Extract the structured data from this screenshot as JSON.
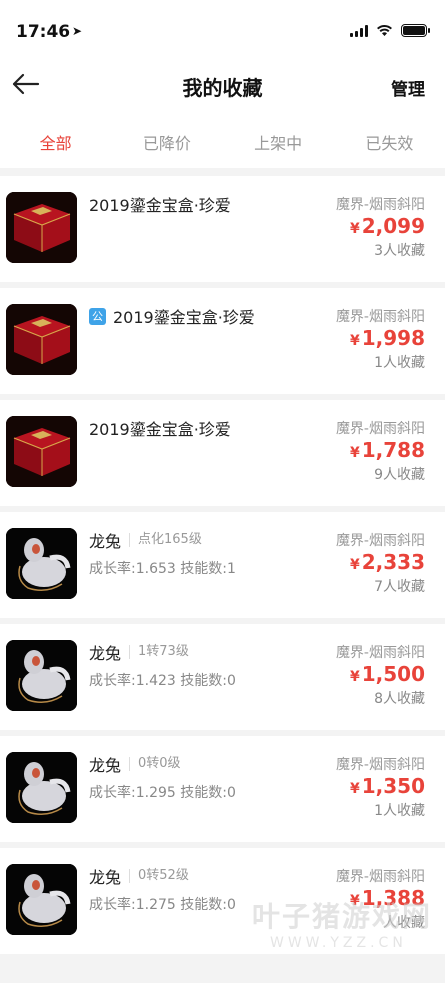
{
  "status": {
    "time": "17:46",
    "location_glyph": "➤"
  },
  "nav": {
    "title": "我的收藏",
    "manage": "管理",
    "back_icon": "arrow-left-icon"
  },
  "tabs": [
    {
      "label": "全部",
      "active": true
    },
    {
      "label": "已降价",
      "active": false
    },
    {
      "label": "上架中",
      "active": false
    },
    {
      "label": "已失效",
      "active": false
    }
  ],
  "items": [
    {
      "name": "2019鎏金宝盒·珍爱",
      "badge": "",
      "level": "",
      "attrs": "",
      "server": "魔界-烟雨斜阳",
      "currency": "¥",
      "price": "2,099",
      "favs": "3人收藏",
      "type": "box"
    },
    {
      "name": "2019鎏金宝盒·珍爱",
      "badge": "公",
      "level": "",
      "attrs": "",
      "server": "魔界-烟雨斜阳",
      "currency": "¥",
      "price": "1,998",
      "favs": "1人收藏",
      "type": "box"
    },
    {
      "name": "2019鎏金宝盒·珍爱",
      "badge": "",
      "level": "",
      "attrs": "",
      "server": "魔界-烟雨斜阳",
      "currency": "¥",
      "price": "1,788",
      "favs": "9人收藏",
      "type": "box"
    },
    {
      "name": "龙兔",
      "badge": "",
      "level": "点化165级",
      "attrs": "成长率:1.653 技能数:1",
      "server": "魔界-烟雨斜阳",
      "currency": "¥",
      "price": "2,333",
      "favs": "7人收藏",
      "type": "pet"
    },
    {
      "name": "龙兔",
      "badge": "",
      "level": "1转73级",
      "attrs": "成长率:1.423 技能数:0",
      "server": "魔界-烟雨斜阳",
      "currency": "¥",
      "price": "1,500",
      "favs": "8人收藏",
      "type": "pet"
    },
    {
      "name": "龙兔",
      "badge": "",
      "level": "0转0级",
      "attrs": "成长率:1.295 技能数:0",
      "server": "魔界-烟雨斜阳",
      "currency": "¥",
      "price": "1,350",
      "favs": "1人收藏",
      "type": "pet"
    },
    {
      "name": "龙兔",
      "badge": "",
      "level": "0转52级",
      "attrs": "成长率:1.275 技能数:0",
      "server": "魔界-烟雨斜阳",
      "currency": "¥",
      "price": "1,388",
      "favs": "人收藏",
      "type": "pet"
    }
  ],
  "watermark": {
    "big": "叶子猪游戏网",
    "small": "WWW.YZZ.CN"
  },
  "colors": {
    "accent": "#e8433a",
    "badge": "#3fa3e8"
  }
}
